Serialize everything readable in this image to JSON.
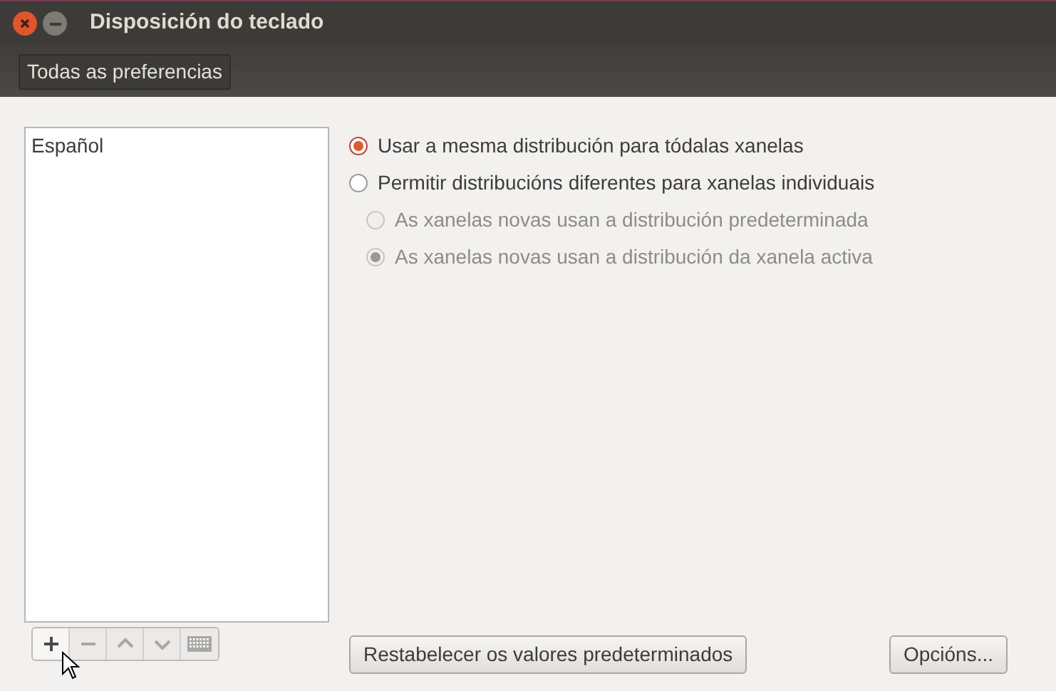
{
  "window": {
    "title": "Disposición do teclado"
  },
  "toolbar": {
    "button": "Todas as preferencias"
  },
  "layouts": {
    "items": [
      {
        "label": "Español",
        "selected": false
      }
    ]
  },
  "list_toolbar": [
    {
      "kind": "add",
      "disabled": false
    },
    {
      "kind": "remove",
      "disabled": true
    },
    {
      "kind": "up",
      "disabled": true
    },
    {
      "kind": "down",
      "disabled": true
    },
    {
      "kind": "keyboard",
      "disabled": true
    }
  ],
  "options": [
    {
      "label": "Usar a mesma distribución para tódalas xanelas",
      "selected": true,
      "disabled": false
    },
    {
      "label": "Permitir distribucións diferentes para xanelas individuais",
      "selected": false,
      "disabled": false,
      "children": [
        {
          "label": "As xanelas novas usan a distribución predeterminada",
          "selected": false,
          "disabled": true
        },
        {
          "label": "As xanelas novas usan a distribución da xanela activa",
          "selected": true,
          "disabled": true
        }
      ]
    }
  ],
  "buttons": {
    "reset": "Restabelecer os valores predeterminados",
    "options": "Opcións..."
  }
}
